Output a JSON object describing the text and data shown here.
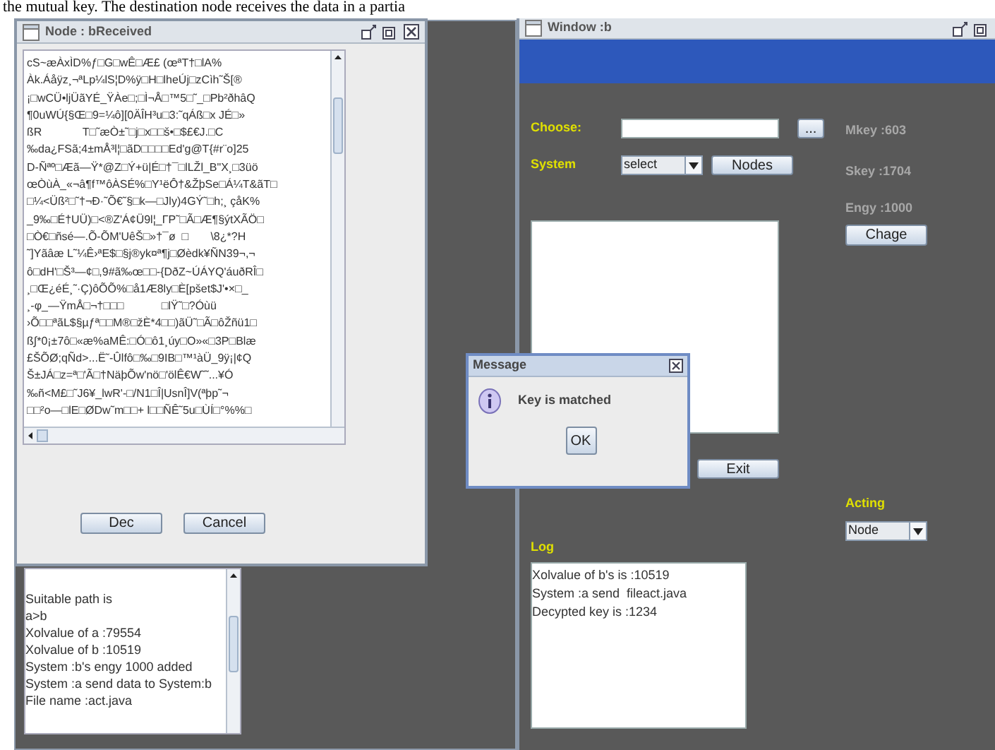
{
  "document_line": "the mutual key. The destination node receives the data in a partia",
  "node_window": {
    "title": "Node : bReceived",
    "received_lines": [
      "cS~æÀxÌD%ƒ□G□wÊ□Æ£ (œªT†□lA%",
      "Àk.Áåÿz¸¬ªLp¼lS¦D%ÿ□H□lheÚj□zCìh˜Š[®",
      "¡□wCÜ•ljÜãYÉ_ŸÀe□;□Ì¬Å□™5□˜_□Pb²ðhâQ",
      "¶0uWÚ{§Œ□9=¼ô][0ÄÎH³u□3:˜qÁß□x JÉ□»",
      "ßR             T□˜æÒ±˜□j□x□□š•□$£€J.□C",
      "‰da¿FSã;4±mÅ³l¦□ãD□□□□Ed'g@T{#r¨o]25",
      "D-Ñªº□Æã—Ÿ*@Z□Ý+ü|É□†¯□lLŽl_B\"X¸□3üö",
      "œÒùÀ_«¬â¶f™ôÀSÉ%□Y¹ëÔ†&ŽþSe□Á¼T&ãT□",
      "□¼<Üß²□˜†¬Ð·˜Õ€˜§□k—□Jly)4GÝ˜□h;¸ çåK%",
      "_9‰□É†UÜ)□<®Z'Á¢Ü9l¦_ΓP˜□Ã□Æ¶§ýtXÃÖ□",
      "□Ò€□ñsé—.Õ-ÕM'UêŠ□»†¯ø  □       \\8¿*?H",
      "˜]Yãâæ L˜¼Ê›ªE$□§j®yk¤ª¶j□Øèdk¥ÑN39¬,¬",
      "ô□dH'□Š³—¢□,9#ã‰œ□□-{DðZ~ÚÁYQ'áuðRÎ□",
      "¸□Œ¿éÉ¸˜·Ç)ôÕÕ%□å1Æ8ly□È[pšet$J'•×□_",
      "¸-φ_—ŸmÅ□¬†□□□            □lŸ˜□?Óùü",
      "›Õ□□ªãL$§µƒª□□M®□žÈ*4□□)ãÜ˜□Ã□ôŽñü1□",
      "ß∫*0¡±7ô□«æ%aMÊ:□Ó□ô1¸úy□O»«□3P□Blæ",
      "£ŠÕØ;qÑd>...Ë˜-Ûlfô□‰□9IB□™¹àÜ_9ÿ¡|¢Q",
      "Š±JÁ□z=ª□'Ã□†NäþÕw'nö□'ölÊ€W˜˜...¥Ó",
      "‰ñ<M£□˜J6¥_lwR'-□/N1□Î|UsnÎ]V(ªþp˜¬",
      "□□²o—□lE□ØDw˜m□□+ l□□ÑÊ˜5u□ÙÍ□°%%□"
    ],
    "buttons": [
      "Dec",
      "Cancel"
    ]
  },
  "node_log": {
    "lines": [
      "Suitable path is",
      "a>b",
      "Xolvalue of a :79554",
      "Xolvalue of b :10519",
      "System :b's engy 1000 added",
      "System :a send data to System:b",
      "File name :act.java"
    ]
  },
  "window_b": {
    "title": "Window :b",
    "choose_label": "Choose:",
    "browse_button": "...",
    "system_label": "System",
    "system_select": "select",
    "nodes_button": "Nodes",
    "mkey": "Mkey :603",
    "skey": "Skey :1704",
    "engy": "Engy :1000",
    "chage_button": "Chage",
    "exit_button": "Exit",
    "acting_label": "Acting",
    "acting_select": "Node",
    "log_label": "Log",
    "log_lines": [
      "Xolvalue of b's is :10519",
      "System :a send  fileact.java",
      "Decypted key is :1234"
    ]
  },
  "message_dialog": {
    "title": "Message",
    "text": "Key is matched",
    "button": "OK"
  }
}
